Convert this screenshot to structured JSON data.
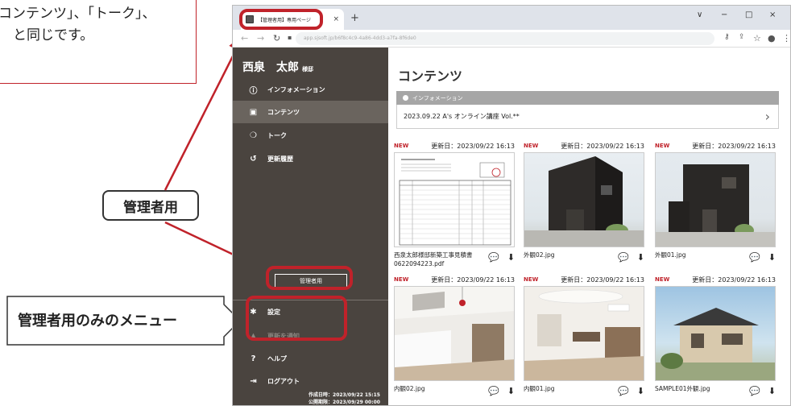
{
  "callouts": {
    "top_line1": "コンテンツ」、「トーク」、",
    "top_line2": "と同じです。",
    "admin_label": "管理者用",
    "admin_menu_label": "管理者用のみのメニュー"
  },
  "browser": {
    "tab_title": "【管理者用】専用ページ",
    "tab_close": "×",
    "new_tab": "+",
    "window_controls": [
      "∨",
      "−",
      "□",
      "×"
    ],
    "url": "app.sjsoft.jp/b6f8c4c9-4a86-4dd3-a7fa-8f6de0"
  },
  "sidebar": {
    "user_name": "西泉　太郎",
    "honorific": "様邸",
    "nav": [
      {
        "label": "インフォメーション",
        "icon": "info-icon"
      },
      {
        "label": "コンテンツ",
        "icon": "image-icon"
      },
      {
        "label": "トーク",
        "icon": "chat-icon"
      },
      {
        "label": "更新履歴",
        "icon": "history-icon"
      }
    ],
    "admin_button": "管理者用",
    "admin_menu": [
      {
        "label": "設定",
        "icon": "gear-icon"
      },
      {
        "label": "更新を通知",
        "icon": "bell-icon"
      }
    ],
    "bottom_menu": [
      {
        "label": "ヘルプ",
        "icon": "help-icon"
      },
      {
        "label": "ログアウト",
        "icon": "logout-icon"
      }
    ],
    "created": "作成日時：2023/09/22 15:15",
    "expires": "公開期限：2023/09/29 00:00"
  },
  "main": {
    "title": "コンテンツ",
    "info_header": "インフォメーション",
    "info_item": "2023.09.22 A's オンライン講座 Vol.**",
    "cards": [
      {
        "new": "NEW",
        "updated": "更新日：2023/09/22 16:13",
        "name": "西泉太郎様邸新築工事見積書0622094223.pdf",
        "kind": "doc"
      },
      {
        "new": "NEW",
        "updated": "更新日：2023/09/22 16:13",
        "name": "外観02.jpg",
        "kind": "ext1"
      },
      {
        "new": "NEW",
        "updated": "更新日：2023/09/22 16:13",
        "name": "外観01.jpg",
        "kind": "ext2"
      },
      {
        "new": "NEW",
        "updated": "更新日：2023/09/22 16:13",
        "name": "内観02.jpg",
        "kind": "int1"
      },
      {
        "new": "NEW",
        "updated": "更新日：2023/09/22 16:13",
        "name": "内観01.jpg",
        "kind": "int2"
      },
      {
        "new": "NEW",
        "updated": "更新日：2023/09/22 16:13",
        "name": "SAMPLE01外観.jpg",
        "kind": "house"
      }
    ]
  },
  "colors": {
    "accent_red": "#c0222a",
    "sidebar": "#4a443f",
    "sidebar_active": "#6a645e"
  }
}
